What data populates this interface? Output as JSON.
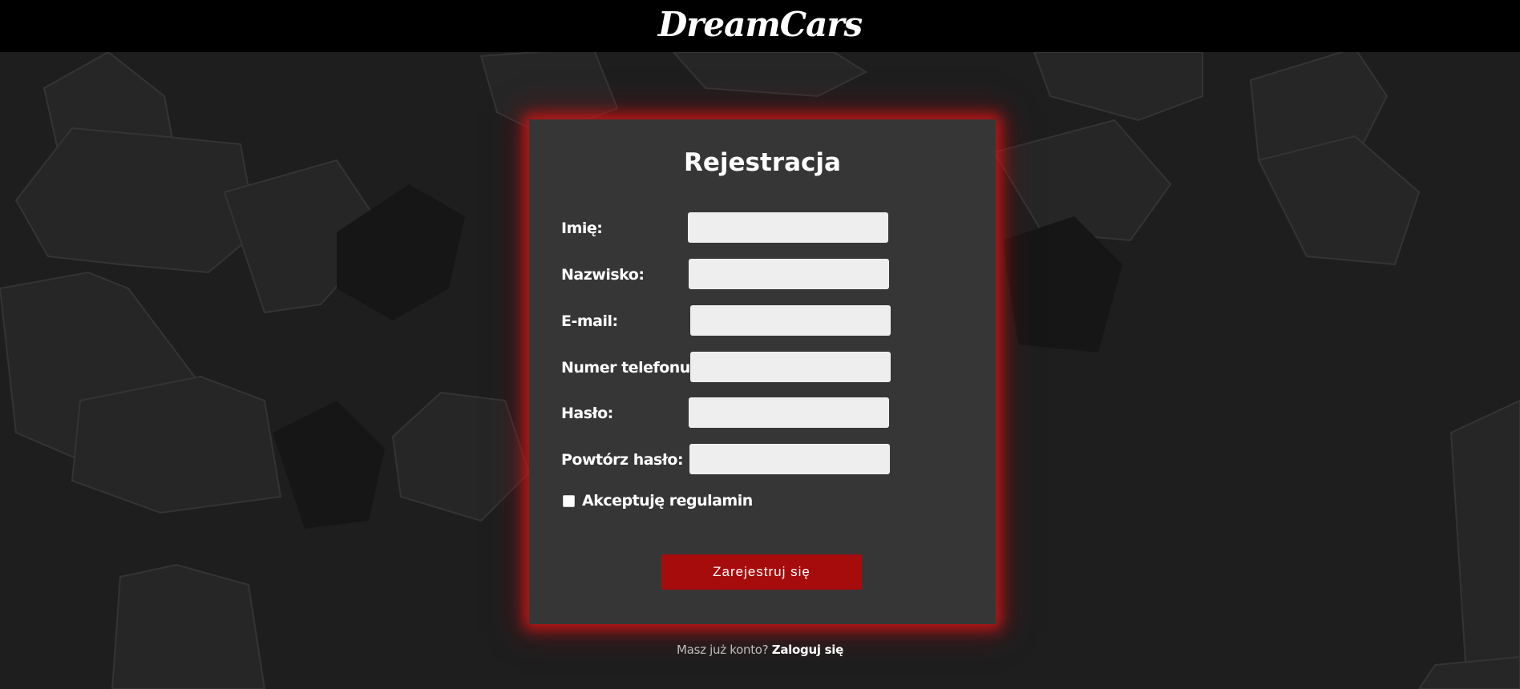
{
  "header": {
    "brand": "DreamCars"
  },
  "form": {
    "title": "Rejestracja",
    "fields": [
      {
        "label": "Imię:",
        "value": "",
        "placeholder": ""
      },
      {
        "label": "Nazwisko:",
        "value": "",
        "placeholder": ""
      },
      {
        "label": "E-mail:",
        "value": "",
        "placeholder": ""
      },
      {
        "label": "Numer telefonu:",
        "value": "",
        "placeholder": ""
      },
      {
        "label": "Hasło:",
        "value": "",
        "placeholder": ""
      },
      {
        "label": "Powtórz hasło:",
        "value": "",
        "placeholder": ""
      }
    ],
    "terms_label": "Akceptuję regulamin",
    "terms_checked": false,
    "submit_label": "Zarejestruj się"
  },
  "footer": {
    "prompt": "Masz już konto?",
    "login_link": "Zaloguj się"
  },
  "colors": {
    "topbar": "#000000",
    "background": "#1d1d1e",
    "card": "#373637",
    "card_glow": "#d61818",
    "button": "#a60c0c",
    "input": "#eeeeee"
  }
}
